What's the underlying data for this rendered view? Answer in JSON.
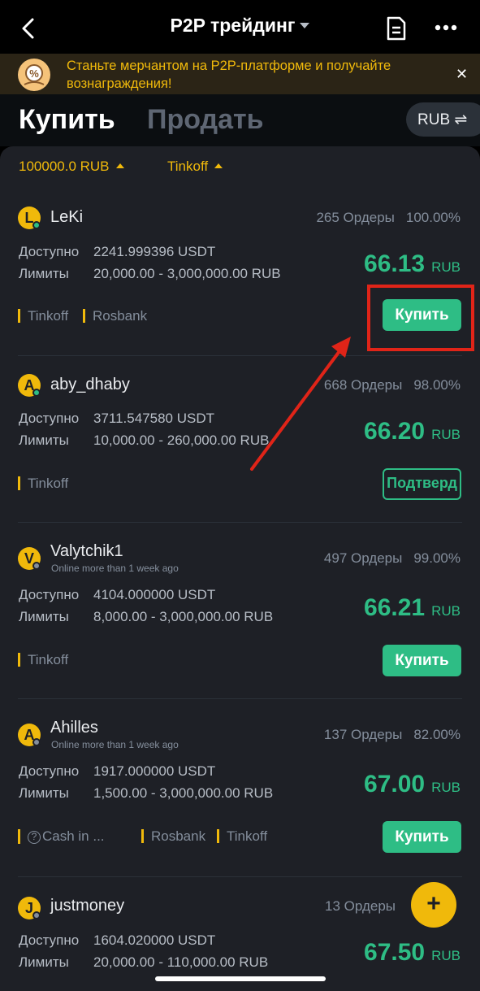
{
  "header": {
    "title": "P2P трейдинг"
  },
  "banner": {
    "text": "Станьте мерчантом на P2P-платформе и получайте вознаграждения!"
  },
  "tabs": {
    "buy": "Купить",
    "sell": "Продать",
    "currency": "RUB ⇌"
  },
  "filters": {
    "amount": "100000.0 RUB",
    "payment": "Tinkoff"
  },
  "labels": {
    "available": "Доступно",
    "limits": "Лимиты",
    "currency": "RUB"
  },
  "ads": [
    {
      "initial": "L",
      "name": "LeKi",
      "online_text": "",
      "orders": "265 Ордеры",
      "completion": "100.00%",
      "available": "2241.999396 USDT",
      "limits": "20,000.00 - 3,000,000.00 RUB",
      "price": "66.13",
      "payments": [
        "Tinkoff",
        "Rosbank"
      ],
      "button": "Купить"
    },
    {
      "initial": "A",
      "name": "aby_dhaby",
      "online_text": "",
      "orders": "668 Ордеры",
      "completion": "98.00%",
      "available": "3711.547580 USDT",
      "limits": "10,000.00 - 260,000.00 RUB",
      "price": "66.20",
      "payments": [
        "Tinkoff"
      ],
      "button": "Подтверд"
    },
    {
      "initial": "V",
      "name": "Valytchik1",
      "online_text": "Online more than 1 week ago",
      "orders": "497 Ордеры",
      "completion": "99.00%",
      "available": "4104.000000 USDT",
      "limits": "8,000.00 - 3,000,000.00 RUB",
      "price": "66.21",
      "payments": [
        "Tinkoff"
      ],
      "button": "Купить"
    },
    {
      "initial": "A",
      "name": "Ahilles",
      "online_text": "Online more than 1 week ago",
      "orders": "137 Ордеры",
      "completion": "82.00%",
      "available": "1917.000000 USDT",
      "limits": "1,500.00 - 3,000,000.00 RUB",
      "price": "67.00",
      "payments": [
        "Cash in ...",
        "Rosbank",
        "Tinkoff"
      ],
      "button": "Купить"
    },
    {
      "initial": "J",
      "name": "justmoney",
      "online_text": "",
      "orders": "13 Ордеры",
      "completion": "",
      "available": "1604.020000 USDT",
      "limits": "20,000.00 - 110,000.00 RUB",
      "price": "67.50",
      "payments": [],
      "button": ""
    }
  ]
}
